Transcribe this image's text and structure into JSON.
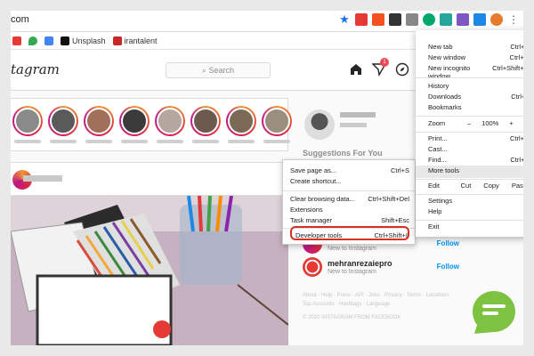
{
  "browser": {
    "url": "com",
    "bookmarks": [
      "Unsplash",
      "irantalent"
    ]
  },
  "instagram": {
    "logo": "tagram",
    "search_placeholder": "Search",
    "notification_count": "1",
    "suggestions_title": "Suggestions For You",
    "suggestions": [
      {
        "name": "",
        "sub": "New to Instagram",
        "follow": "Follow"
      },
      {
        "name": "mehranrezaiepro",
        "sub": "New to Instagram",
        "follow": "Follow"
      }
    ],
    "footer_links": "About · Help · Press · API · Jobs · Privacy · Terms · Locations · Top Accounts · Hashtags · Language",
    "copyright": "© 2020 INSTAGRAM FROM FACEBOOK"
  },
  "context_menu": {
    "items": [
      {
        "label": "Save page as...",
        "shortcut": "Ctrl+S"
      },
      {
        "label": "Create shortcut...",
        "shortcut": ""
      },
      {
        "label": "Clear browsing data...",
        "shortcut": "Ctrl+Shift+Del"
      },
      {
        "label": "Extensions",
        "shortcut": ""
      },
      {
        "label": "Task manager",
        "shortcut": "Shift+Esc"
      },
      {
        "label": "Developer tools",
        "shortcut": "Ctrl+Shift+I"
      }
    ]
  },
  "chrome_menu": {
    "new_tab": {
      "label": "New tab",
      "shortcut": "Ctrl+T"
    },
    "new_window": {
      "label": "New window",
      "shortcut": "Ctrl+N"
    },
    "new_incognito": {
      "label": "New incognito window",
      "shortcut": "Ctrl+Shift+N"
    },
    "history": {
      "label": "History",
      "shortcut": ""
    },
    "downloads": {
      "label": "Downloads",
      "shortcut": "Ctrl+J"
    },
    "bookmarks": {
      "label": "Bookmarks",
      "shortcut": ""
    },
    "zoom": {
      "label": "Zoom",
      "minus": "–",
      "value": "100%",
      "plus": "+"
    },
    "print": {
      "label": "Print...",
      "shortcut": "Ctrl+P"
    },
    "cast": {
      "label": "Cast...",
      "shortcut": ""
    },
    "find": {
      "label": "Find...",
      "shortcut": "Ctrl+F"
    },
    "more_tools": {
      "label": "More tools",
      "shortcut": ""
    },
    "edit": {
      "label": "Edit",
      "cut": "Cut",
      "copy": "Copy",
      "paste": "Paste"
    },
    "settings": {
      "label": "Settings",
      "shortcut": ""
    },
    "help": {
      "label": "Help",
      "shortcut": ""
    },
    "exit": {
      "label": "Exit",
      "shortcut": ""
    }
  }
}
